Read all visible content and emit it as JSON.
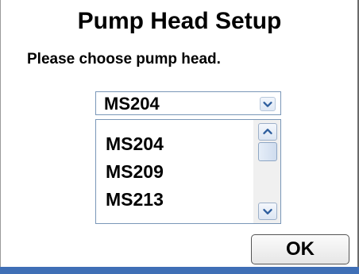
{
  "dialog": {
    "title": "Pump Head Setup",
    "prompt": "Please choose pump head."
  },
  "pump_head_select": {
    "selected": "MS204",
    "options": [
      "MS204",
      "MS209",
      "MS213"
    ]
  },
  "ok_button": {
    "label": "OK"
  },
  "colors": {
    "accent_bar": "#3f6fb6",
    "control_border": "#7a97b8",
    "chevron": "#2f5f9e"
  },
  "icons": {
    "dropdown": "chevron-down-icon",
    "scroll_up": "chevron-up-icon",
    "scroll_down": "chevron-down-icon"
  }
}
